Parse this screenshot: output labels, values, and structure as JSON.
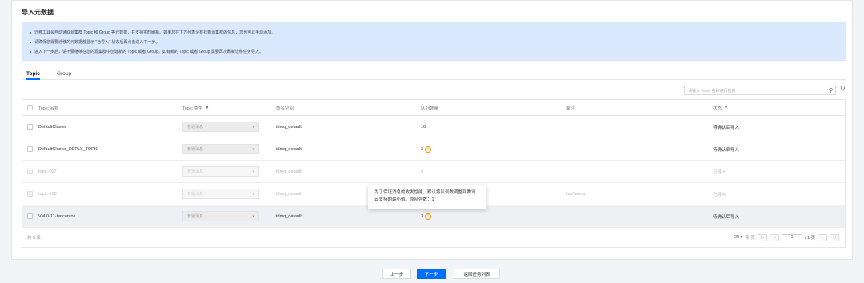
{
  "title": "导入元数据",
  "notice": [
    "迁移工具会自动读取源集群 Topic 和 Group 等元数据，并支持实时刷新。如果您在下方列表没有找到源集群的信息，您也可以手动添加。",
    "请确保您需要迁移的元数据都显示 \"已导入\" 状态后再点击进入下一步。",
    "进入下一步后，请不要继续在您的源集群中创建新的 Topic 或者 Group。如有新的 Topic 或者 Group 需要再次刷新迁移任务导入。"
  ],
  "tabs": [
    "Topic",
    "Group"
  ],
  "search": {
    "placeholder": "请输入 Topic 名称进行检索"
  },
  "table": {
    "headers": {
      "name": "Topic 名称",
      "type": "Topic 类型",
      "namespace": "命名空间",
      "queue": "队列数量",
      "remark": "备注",
      "status": "状态"
    },
    "rows": [
      {
        "name": "DefaultCluster",
        "type": "普通消息",
        "namespace": "tdmq_default",
        "queue": "16",
        "warn": "",
        "remark": "",
        "status": "待确认后导入"
      },
      {
        "name": "DefaultCluster_REPLY_TOPIC",
        "type": "普通消息",
        "namespace": "tdmq_default",
        "queue": "3",
        "warn": "!",
        "remark": "",
        "status": "待确认后导入"
      },
      {
        "name": "topic-027",
        "type": "普通消息",
        "namespace": "tdmq_default",
        "queue": "4",
        "warn": "",
        "remark": "",
        "status": "已导入"
      },
      {
        "name": "topic-028",
        "type": "普通消息",
        "namespace": "tdmq_default",
        "queue": "",
        "warn": "",
        "remark": "test/weqq",
        "status": "已导入"
      },
      {
        "name": "VM-0-11-tencentos",
        "type": "普通消息",
        "namespace": "tdmq_default",
        "queue": "3",
        "warn": "!",
        "remark": "",
        "status": "待确认后导入"
      }
    ],
    "total": "共 5 条",
    "page_size": "20",
    "page_size_unit": "条/页",
    "current_page": "1",
    "total_pages": "/ 1 页"
  },
  "tooltip": {
    "line1": "为了保证消息的收发性能，默认将队列数调整到腾讯",
    "line2": "云支持的最小值。原队列数：1"
  },
  "buttons": {
    "prev": "上一步",
    "next": "下一步",
    "back": "返回任务列表"
  },
  "colors": {
    "primary": "#006eff",
    "notice_bg": "#dbe9ff",
    "warning": "#f08c00"
  }
}
